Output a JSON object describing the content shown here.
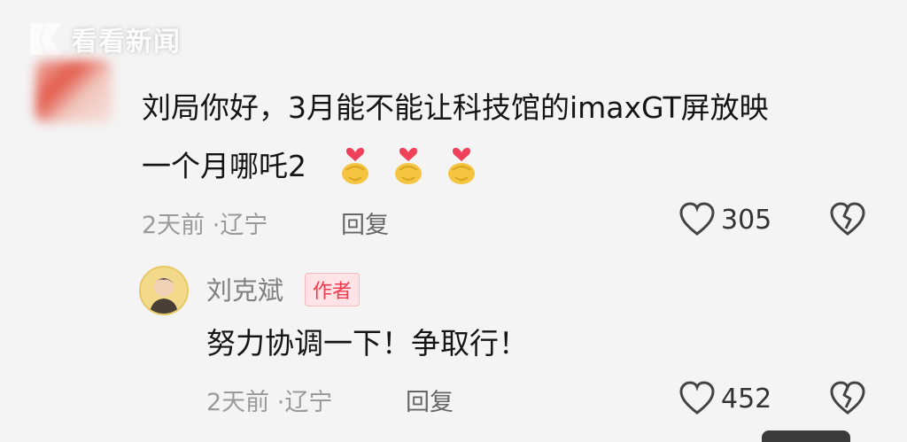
{
  "watermark": {
    "text": "看看新闻"
  },
  "comment": {
    "line1": "刘局你好，3月能不能让科技馆的imaxGT屏放映",
    "line2": "一个月哪吒2",
    "emoji_count": 3,
    "time": "2天前",
    "dot": "·",
    "location": "辽宁",
    "reply_label": "回复",
    "likes": "305"
  },
  "reply": {
    "author": "刘克斌",
    "badge": "作者",
    "text": "努力协调一下！争取行！",
    "time": "2天前",
    "dot": "·",
    "location": "辽宁",
    "reply_label": "回复",
    "likes": "452"
  },
  "colors": {
    "background": "#f4f4f4",
    "text": "#151515",
    "meta": "#9a9a9a",
    "badge_bg": "#ffe3e6",
    "badge_text": "#f23b4c"
  },
  "icons": {
    "emoji": "finger-heart-emoji",
    "like": "heart-outline-icon",
    "dislike": "broken-heart-icon"
  }
}
